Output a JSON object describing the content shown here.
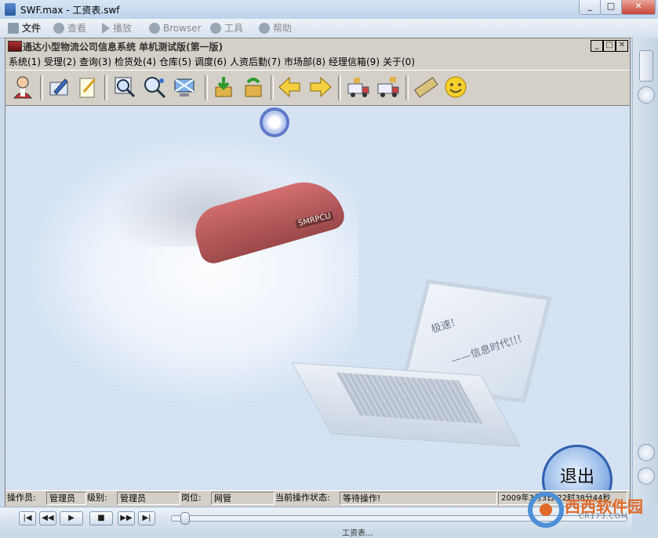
{
  "window": {
    "title": "SWF.max - 工资表.swf",
    "buttons": [
      "_",
      "□",
      "✕"
    ]
  },
  "outer_toolbar": [
    {
      "label": "文件",
      "icon": "file-icon",
      "enabled": true
    },
    {
      "label": "查看",
      "icon": "view-icon",
      "enabled": false
    },
    {
      "label": "播放",
      "icon": "play-icon",
      "enabled": false
    },
    {
      "label": "Browser",
      "icon": "browser-icon",
      "enabled": false
    },
    {
      "label": "工具",
      "icon": "gear-icon",
      "enabled": false
    },
    {
      "label": "帮助",
      "icon": "help-icon",
      "enabled": false
    }
  ],
  "inner": {
    "title": "通达小型物流公司信息系统  单机测试版(第一版)",
    "buttons": [
      "_",
      "□",
      "✕"
    ],
    "menu": [
      "系统(1)",
      "受理(2)",
      "查询(3)",
      "检货处(4)",
      "仓库(5)",
      "调度(6)",
      "人资后勤(7)",
      "市场部(8)",
      "经理信箱(9)",
      "关于(0)"
    ],
    "toolbar": [
      "user-icon",
      "edit-form-icon",
      "notepad-icon",
      "magnifier-icon",
      "search-people-icon",
      "network-monitor-icon",
      "download-box-icon",
      "refresh-box-icon",
      "back-arrow-icon",
      "forward-arrow-icon",
      "truck-load-icon",
      "truck-unload-icon",
      "film-icon",
      "smiley-icon"
    ],
    "slogan_line1": "极速!",
    "slogan_line2": "——信息时代!!!",
    "car_plate": "SMRPCU",
    "exit_label": "退出",
    "status": {
      "operator_label": "操作员:",
      "operator_value": "管理员",
      "level_label": "级别:",
      "level_value": "管理员",
      "post_label": "岗位:",
      "post_value": "网管",
      "state_label": "当前操作状态:",
      "state_value": "等待操作!",
      "datetime": "2009年3月3日 22时38分44秒"
    }
  },
  "player": {
    "buttons": [
      "|◀",
      "◀◀",
      "▶",
      "■",
      "▶▶",
      "▶|"
    ],
    "file_label": "工资表...",
    "progress": 0.02
  },
  "watermark": {
    "text": "西西软件园",
    "sub": "CR173.COM"
  }
}
